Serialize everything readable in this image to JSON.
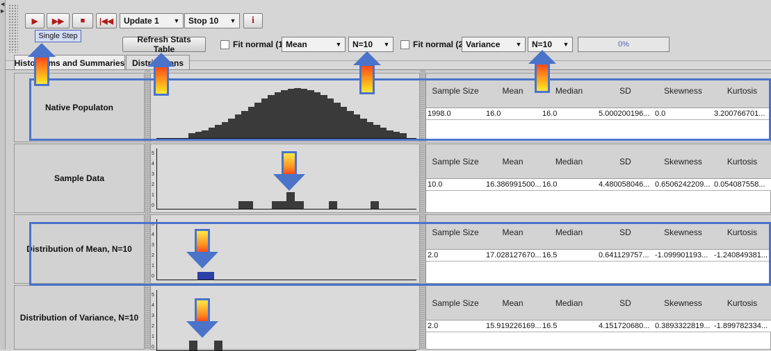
{
  "toolbar": {
    "update_selected": "Update 1",
    "stop_selected": "Stop 10",
    "tooltip": "Single Step",
    "refresh_label": "Refresh Stats Table",
    "fit1_label": "Fit normal (1)",
    "stat1_selected": "Mean",
    "n1_selected": "N=10",
    "fit2_label": "Fit normal (2)",
    "stat2_selected": "Variance",
    "n2_selected": "N=10",
    "progress_text": "0%",
    "progress_value": 0
  },
  "tabs": [
    {
      "label": "Histograms and Summaries",
      "active": true
    },
    {
      "label": "Distributions",
      "active": false
    }
  ],
  "stat_headers": [
    "Sample Size",
    "Mean",
    "Median",
    "SD",
    "Skewness",
    "Kurtosis"
  ],
  "rows": [
    {
      "label": "Native Populaton",
      "values": [
        "1998.0",
        "16.0",
        "16.0",
        "5.000200196...",
        "0.0",
        "3.200766701..."
      ]
    },
    {
      "label": "Sample Data",
      "values": [
        "10.0",
        "16.386991500...",
        "16.0",
        "4.480058046...",
        "0.6506242209...",
        "0.054087558..."
      ]
    },
    {
      "label": "Distribution of Mean, N=10",
      "values": [
        "2.0",
        "17.028127670...",
        "16.5",
        "0.641129757...",
        "-1.099901193...",
        "-1.240849381..."
      ]
    },
    {
      "label": "Distribution of Variance, N=10",
      "values": [
        "2.0",
        "15.919226169...",
        "16.5",
        "4.151720680...",
        "0.3893322819...",
        "-1.899782334..."
      ]
    }
  ],
  "axis_ticks": [
    "5",
    "4",
    "3",
    "2",
    "1",
    "0"
  ],
  "colors": {
    "highlight": "#4a73c9",
    "toolbar_icon": "#b21818",
    "sampled_bar": "#2c40a8"
  }
}
